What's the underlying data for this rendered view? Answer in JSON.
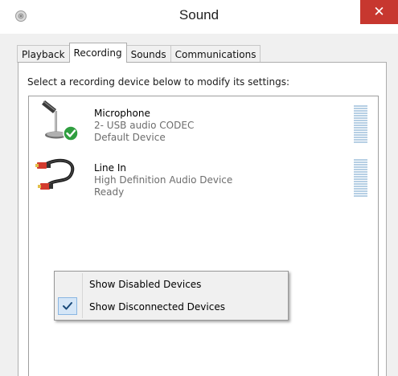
{
  "window": {
    "title": "Sound",
    "close_glyph": "✕",
    "app_icon": "speaker-icon"
  },
  "tabs": [
    {
      "label": "Playback",
      "active": false
    },
    {
      "label": "Recording",
      "active": true
    },
    {
      "label": "Sounds",
      "active": false
    },
    {
      "label": "Communications",
      "active": false
    }
  ],
  "instructions": "Select a recording device below to modify its settings:",
  "devices": [
    {
      "name": "Microphone",
      "line2": "2- USB audio CODEC",
      "line3": "Default Device",
      "icon": "microphone-icon",
      "default_badge": "green-check-icon",
      "level": 0
    },
    {
      "name": "Line In",
      "line2": "High Definition Audio Device",
      "line3": "Ready",
      "icon": "rca-cable-icon",
      "level": 0
    }
  ],
  "context_menu": {
    "items": [
      {
        "label": "Show Disabled Devices",
        "checked": false
      },
      {
        "label": "Show Disconnected Devices",
        "checked": true
      }
    ]
  },
  "colors": {
    "close_button": "#c7372f",
    "level_meter": "#b6cfe4",
    "checked_highlight": "#d5e6f7",
    "check_mark": "#1a4a7a"
  }
}
